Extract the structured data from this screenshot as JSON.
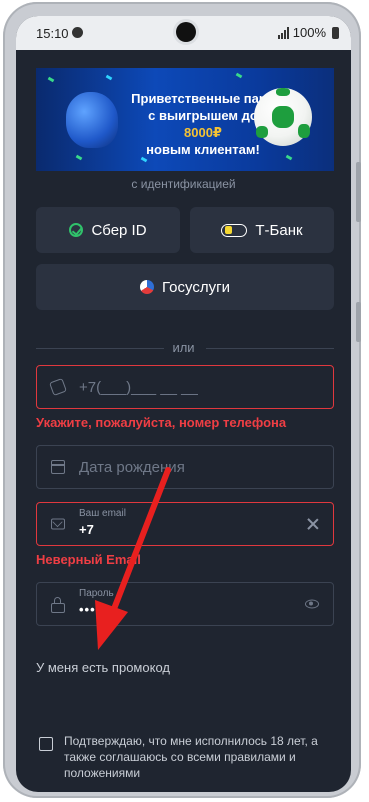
{
  "status_bar": {
    "time": "15:10",
    "battery": "100%"
  },
  "banner": {
    "line1": "Приветственные пари",
    "line2_pre": "с выигрышем до ",
    "line2_highlight": "8000₽",
    "line3": "новым клиентам!"
  },
  "auth": {
    "with_id_label": "с идентификацией",
    "sber_label": "Сбер ID",
    "tbank_label": "Т-Банк",
    "gos_label": "Госуслуги",
    "or_label": "или"
  },
  "phone_field": {
    "placeholder": "+7(___)___ __ __",
    "error": "Укажите, пожалуйста, номер телефона"
  },
  "birth_field": {
    "placeholder": "Дата рождения"
  },
  "email_field": {
    "label": "Ваш email",
    "value": "+7",
    "error": "Неверный Email"
  },
  "password_field": {
    "label": "Пароль",
    "value": "•••••••"
  },
  "promo_link": "У меня есть промокод",
  "consent_text": "Подтверждаю, что мне исполнилось 18 лет, а также соглашаюсь со всеми правилами и положениями",
  "colors": {
    "background": "#1f2530",
    "button": "#2b3240",
    "error": "#e0383e",
    "highlight": "#f5c233",
    "annotation_arrow": "#e8201f"
  }
}
